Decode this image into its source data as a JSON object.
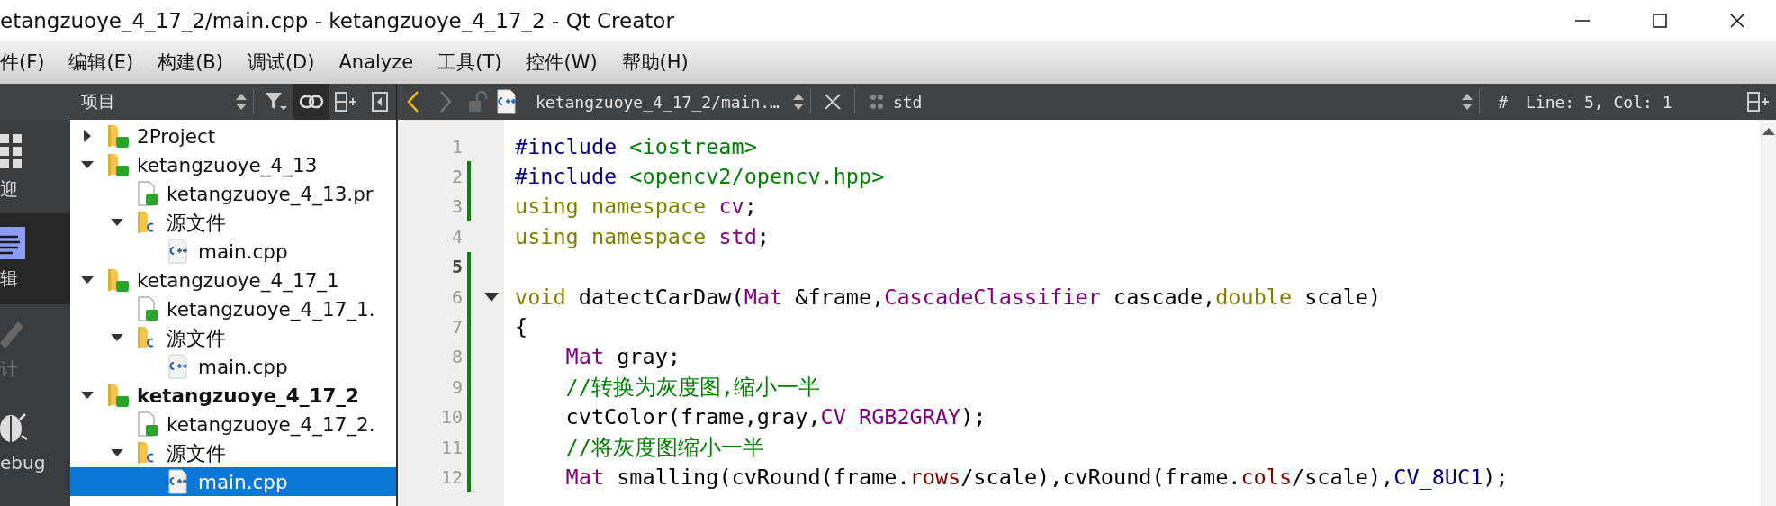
{
  "window": {
    "title": "etangzuoye_4_17_2/main.cpp - ketangzuoye_4_17_2 - Qt Creator"
  },
  "menu": [
    "件(F)",
    "编辑(E)",
    "构建(B)",
    "调试(D)",
    "Analyze",
    "工具(T)",
    "控件(W)",
    "帮助(H)"
  ],
  "modes": [
    {
      "label": "迎",
      "kind": "welcome",
      "selected": false,
      "disabled": false
    },
    {
      "label": "辑",
      "kind": "edit",
      "selected": true,
      "disabled": false
    },
    {
      "label": "计",
      "kind": "design",
      "selected": false,
      "disabled": true
    },
    {
      "label": "ebug",
      "kind": "debug",
      "selected": false,
      "disabled": false
    }
  ],
  "project_pane": {
    "title": "项目",
    "sync_active": true,
    "tree": [
      {
        "label": "2Project",
        "kind": "project",
        "active": false,
        "expanded": false,
        "selected": false
      },
      {
        "label": "ketangzuoye_4_13",
        "kind": "project",
        "active": false,
        "expanded": true,
        "selected": false,
        "children": [
          {
            "label": "ketangzuoye_4_13.pr",
            "kind": "pro-file",
            "selected": false
          },
          {
            "label": "源文件",
            "kind": "source-folder",
            "expanded": true,
            "selected": false,
            "children": [
              {
                "label": "main.cpp",
                "kind": "cpp-file",
                "selected": false
              }
            ]
          }
        ]
      },
      {
        "label": "ketangzuoye_4_17_1",
        "kind": "project",
        "active": false,
        "expanded": true,
        "selected": false,
        "children": [
          {
            "label": "ketangzuoye_4_17_1.",
            "kind": "pro-file",
            "selected": false
          },
          {
            "label": "源文件",
            "kind": "source-folder",
            "expanded": true,
            "selected": false,
            "children": [
              {
                "label": "main.cpp",
                "kind": "cpp-file",
                "selected": false
              }
            ]
          }
        ]
      },
      {
        "label": "ketangzuoye_4_17_2",
        "kind": "project",
        "active": true,
        "expanded": true,
        "selected": false,
        "children": [
          {
            "label": "ketangzuoye_4_17_2.",
            "kind": "pro-file",
            "selected": false
          },
          {
            "label": "源文件",
            "kind": "source-folder",
            "expanded": true,
            "selected": false,
            "children": [
              {
                "label": "main.cpp",
                "kind": "cpp-file",
                "selected": true
              }
            ]
          }
        ]
      }
    ]
  },
  "editor_toolbar": {
    "file": "ketangzuoye_4_17_2/main.…",
    "symbol": "std",
    "hash": "#",
    "position": "Line: 5, Col: 1"
  },
  "code": [
    {
      "number": "1",
      "changed": false,
      "current": false,
      "fold_marker": false,
      "tokens": [
        {
          "kind": "preproc",
          "text": "#include"
        },
        {
          "kind": "string",
          "text": " <iostream>"
        }
      ]
    },
    {
      "number": "2",
      "changed": true,
      "current": false,
      "fold_marker": false,
      "tokens": [
        {
          "kind": "preproc",
          "text": "#include"
        },
        {
          "kind": "string",
          "text": " <opencv2/opencv.hpp>"
        }
      ]
    },
    {
      "number": "3",
      "changed": true,
      "current": false,
      "fold_marker": false,
      "tokens": [
        {
          "kind": "keyword",
          "text": "using namespace"
        },
        {
          "kind": "type",
          "text": " cv"
        },
        {
          "kind": "plain",
          "text": ";"
        }
      ]
    },
    {
      "number": "4",
      "changed": false,
      "current": false,
      "fold_marker": false,
      "tokens": [
        {
          "kind": "keyword",
          "text": "using namespace"
        },
        {
          "kind": "type",
          "text": " std"
        },
        {
          "kind": "plain",
          "text": ";"
        }
      ]
    },
    {
      "number": "5",
      "changed": true,
      "current": true,
      "fold_marker": false
    },
    {
      "number": "6",
      "changed": true,
      "current": false,
      "fold_marker": true,
      "tokens": [
        {
          "kind": "keyword",
          "text": "void"
        },
        {
          "kind": "plain",
          "text": " datectCarDaw("
        },
        {
          "kind": "type",
          "text": "Mat"
        },
        {
          "kind": "plain",
          "text": " &frame,"
        },
        {
          "kind": "type",
          "text": "CascadeClassifier"
        },
        {
          "kind": "plain",
          "text": " cascade,"
        },
        {
          "kind": "keyword",
          "text": "double"
        },
        {
          "kind": "plain",
          "text": " scale)"
        }
      ]
    },
    {
      "number": "7",
      "changed": true,
      "current": false,
      "fold_marker": false,
      "tokens": [
        {
          "kind": "plain",
          "text": "{"
        }
      ]
    },
    {
      "number": "8",
      "changed": true,
      "current": false,
      "fold_marker": false,
      "tokens": [
        {
          "kind": "type",
          "text": "    Mat"
        },
        {
          "kind": "plain",
          "text": " gray;"
        }
      ]
    },
    {
      "number": "9",
      "changed": true,
      "current": false,
      "fold_marker": false,
      "tokens": [
        {
          "kind": "comment",
          "text": "    //转换为灰度图,缩小一半"
        }
      ]
    },
    {
      "number": "10",
      "changed": true,
      "current": false,
      "fold_marker": false,
      "tokens": [
        {
          "kind": "plain",
          "text": "    cvtColor(frame,gray,"
        },
        {
          "kind": "type",
          "text": "CV_RGB2GRAY"
        },
        {
          "kind": "plain",
          "text": ");"
        }
      ]
    },
    {
      "number": "11",
      "changed": true,
      "current": false,
      "fold_marker": false,
      "tokens": [
        {
          "kind": "comment",
          "text": "    //将灰度图缩小一半"
        }
      ]
    },
    {
      "number": "12",
      "changed": true,
      "current": false,
      "fold_marker": false,
      "tokens": [
        {
          "kind": "type",
          "text": "    Mat"
        },
        {
          "kind": "plain",
          "text": " smalling(cvRound(frame."
        },
        {
          "kind": "field",
          "text": "rows"
        },
        {
          "kind": "plain",
          "text": "/scale),cvRound(frame."
        },
        {
          "kind": "field",
          "text": "cols"
        },
        {
          "kind": "plain",
          "text": "/scale),"
        },
        {
          "kind": "enum",
          "text": "CV_8UC1"
        },
        {
          "kind": "plain",
          "text": ");"
        }
      ]
    }
  ]
}
